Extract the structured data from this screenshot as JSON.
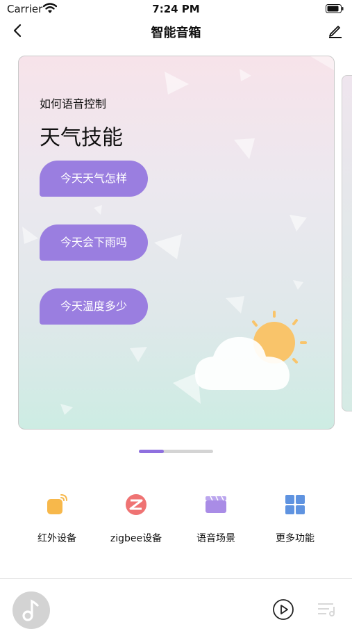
{
  "status_bar": {
    "carrier": "Carrier",
    "time": "7:24 PM"
  },
  "nav": {
    "title": "智能音箱"
  },
  "card": {
    "subtitle": "如何语音控制",
    "title": "天气技能",
    "commands": [
      "今天天气怎样",
      "今天会下雨吗",
      "今天温度多少"
    ]
  },
  "carousel": {
    "current": 1
  },
  "functions": [
    {
      "label": "红外设备",
      "icon": "infrared-remote-icon",
      "color": "#f7b84b"
    },
    {
      "label": "zigbee设备",
      "icon": "zigbee-icon",
      "color": "#ef7373"
    },
    {
      "label": "语音场景",
      "icon": "voice-scene-icon",
      "color": "#a98ce6"
    },
    {
      "label": "更多功能",
      "icon": "grid-more-icon",
      "color": "#5f93e0"
    }
  ],
  "colors": {
    "accent": "#8f70df",
    "bubble": "#9a7ee0"
  }
}
